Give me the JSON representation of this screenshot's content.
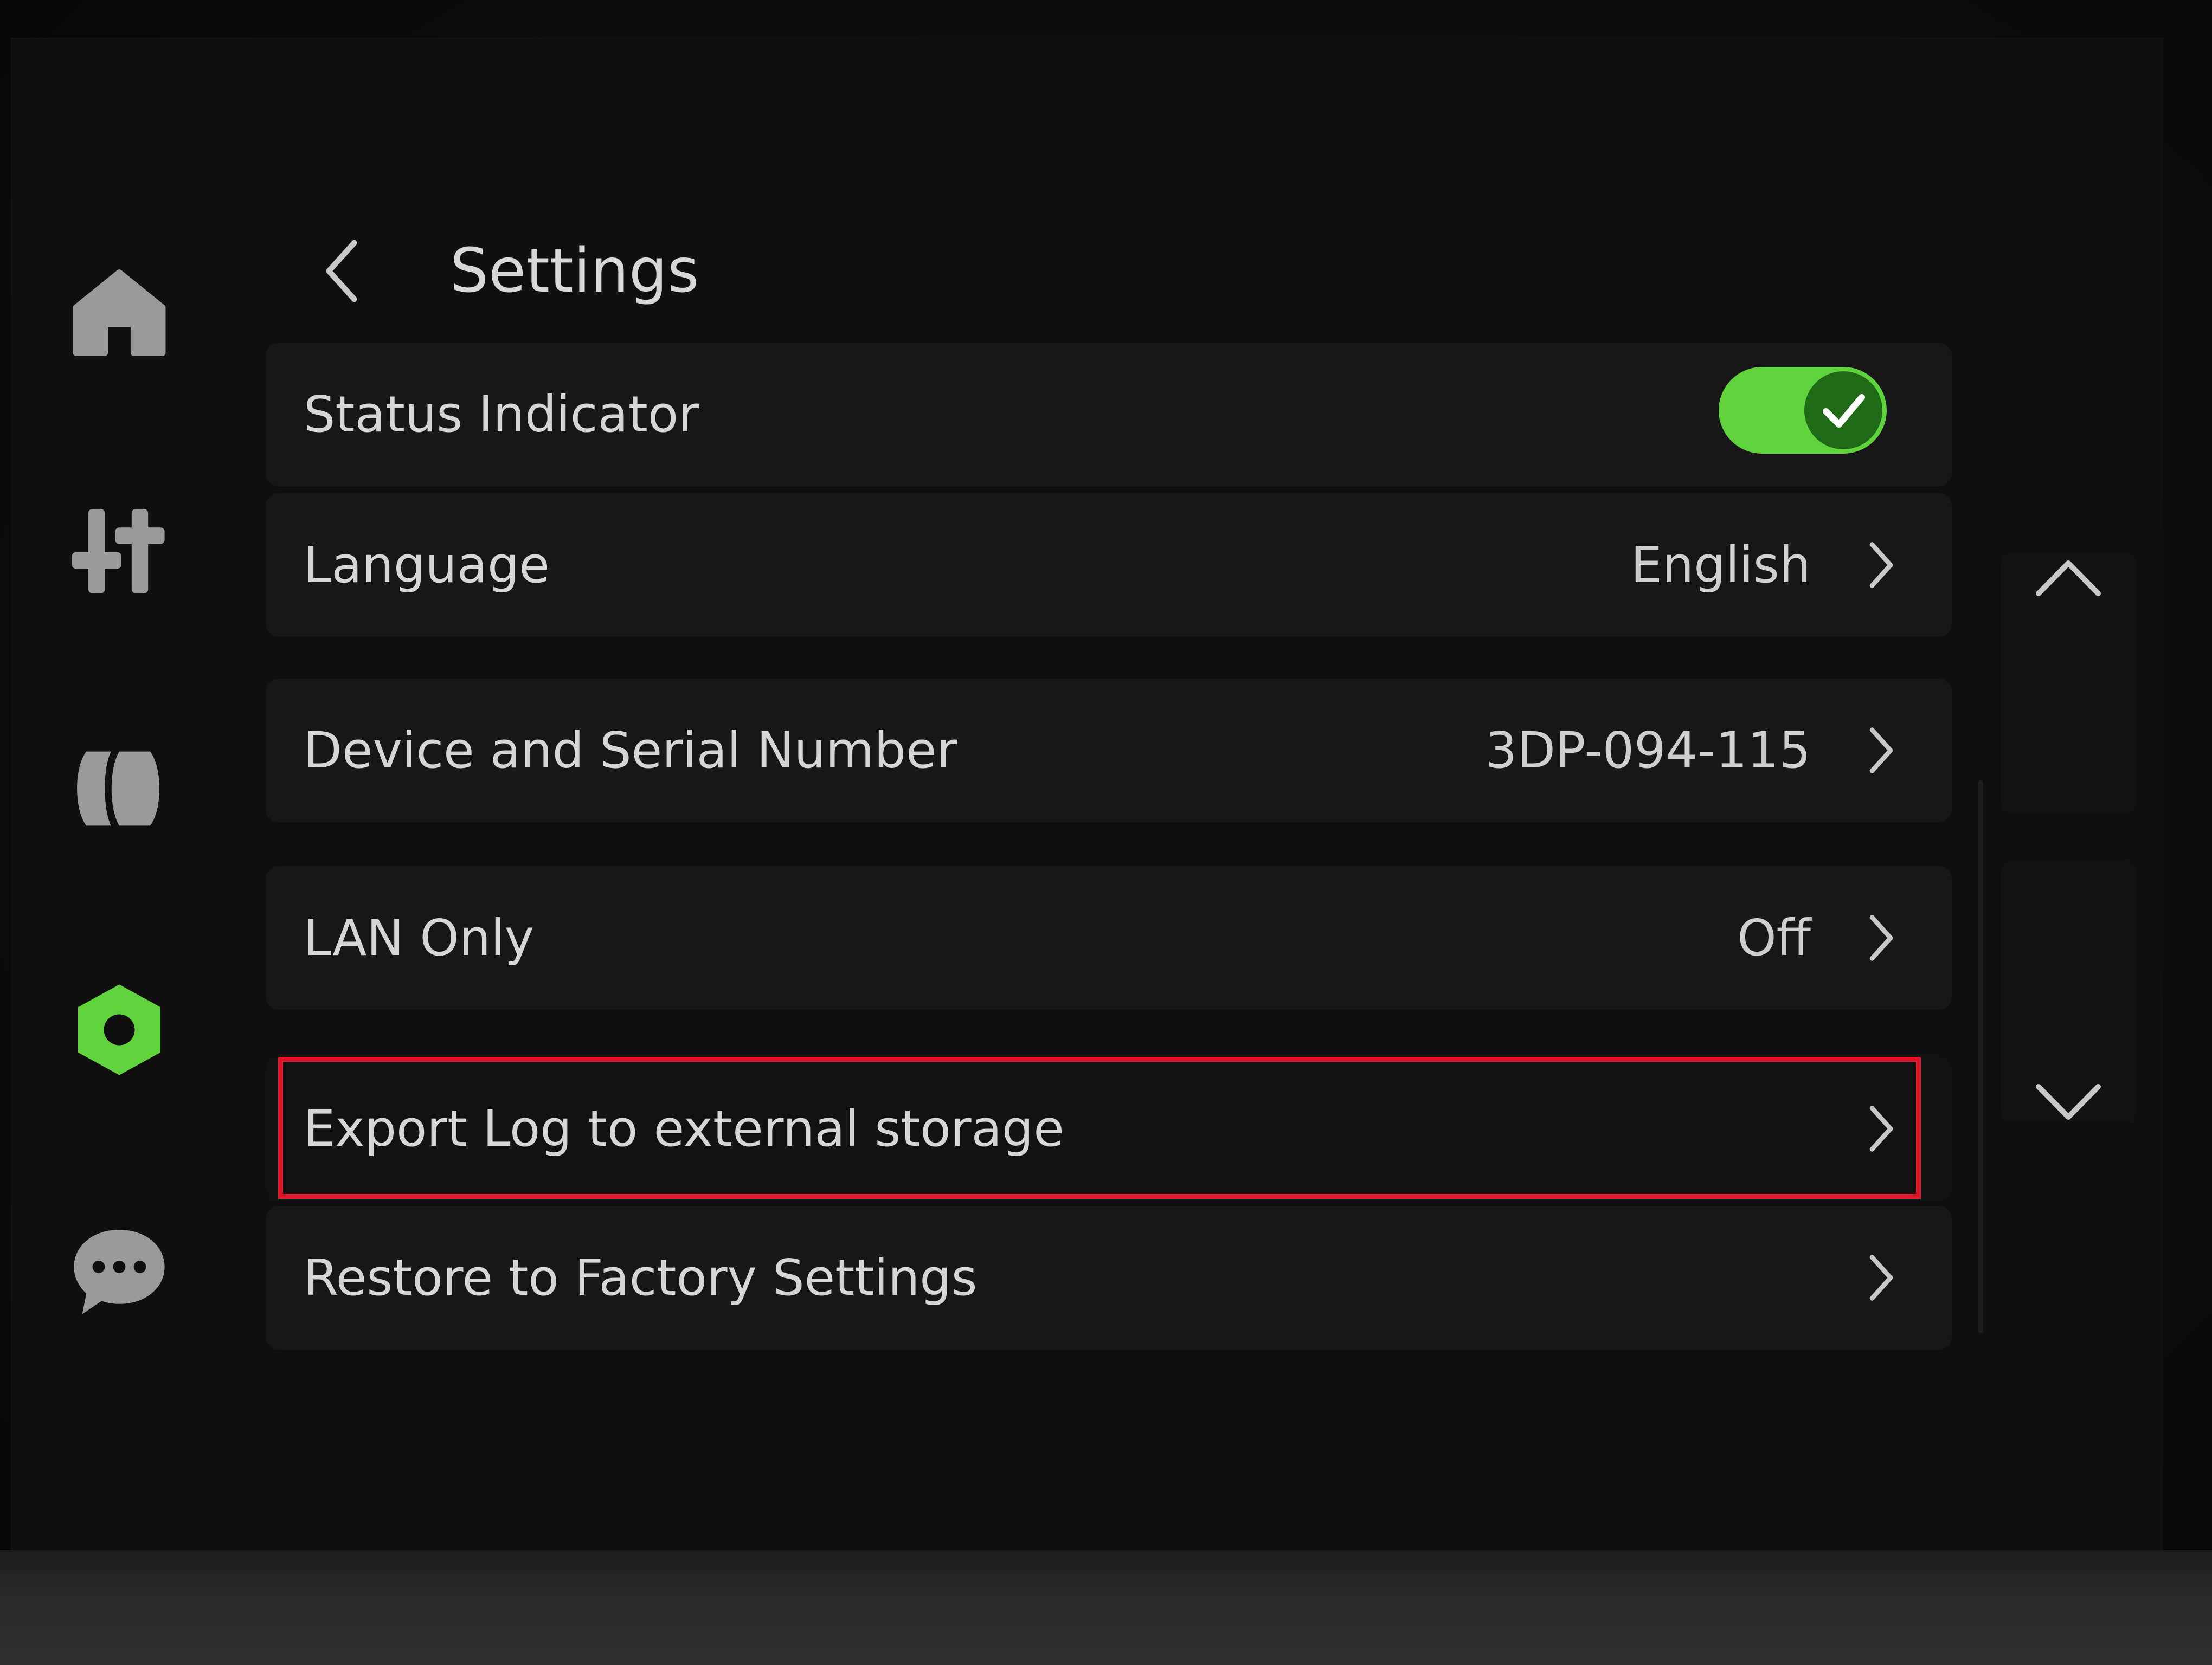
{
  "header": {
    "title": "Settings"
  },
  "sidebar": {
    "items": [
      {
        "icon": "home-icon"
      },
      {
        "icon": "controls-icon"
      },
      {
        "icon": "filament-icon"
      },
      {
        "icon": "settings-icon",
        "active": true
      },
      {
        "icon": "messages-icon"
      }
    ]
  },
  "settings": {
    "rows": [
      {
        "label": "Status Indicator",
        "toggle": true
      },
      {
        "label": "Language",
        "value": "English"
      },
      {
        "label": "Device and Serial Number",
        "value": "3DP-094-115"
      },
      {
        "label": "LAN Only",
        "value": "Off"
      },
      {
        "label": "Export Log to external storage",
        "value": "",
        "highlighted": true
      },
      {
        "label": "Restore to Factory Settings",
        "value": ""
      }
    ]
  },
  "colors": {
    "accent": "#5fd23c",
    "highlight": "#e2162b",
    "icon_inactive": "#9a9a9a"
  }
}
